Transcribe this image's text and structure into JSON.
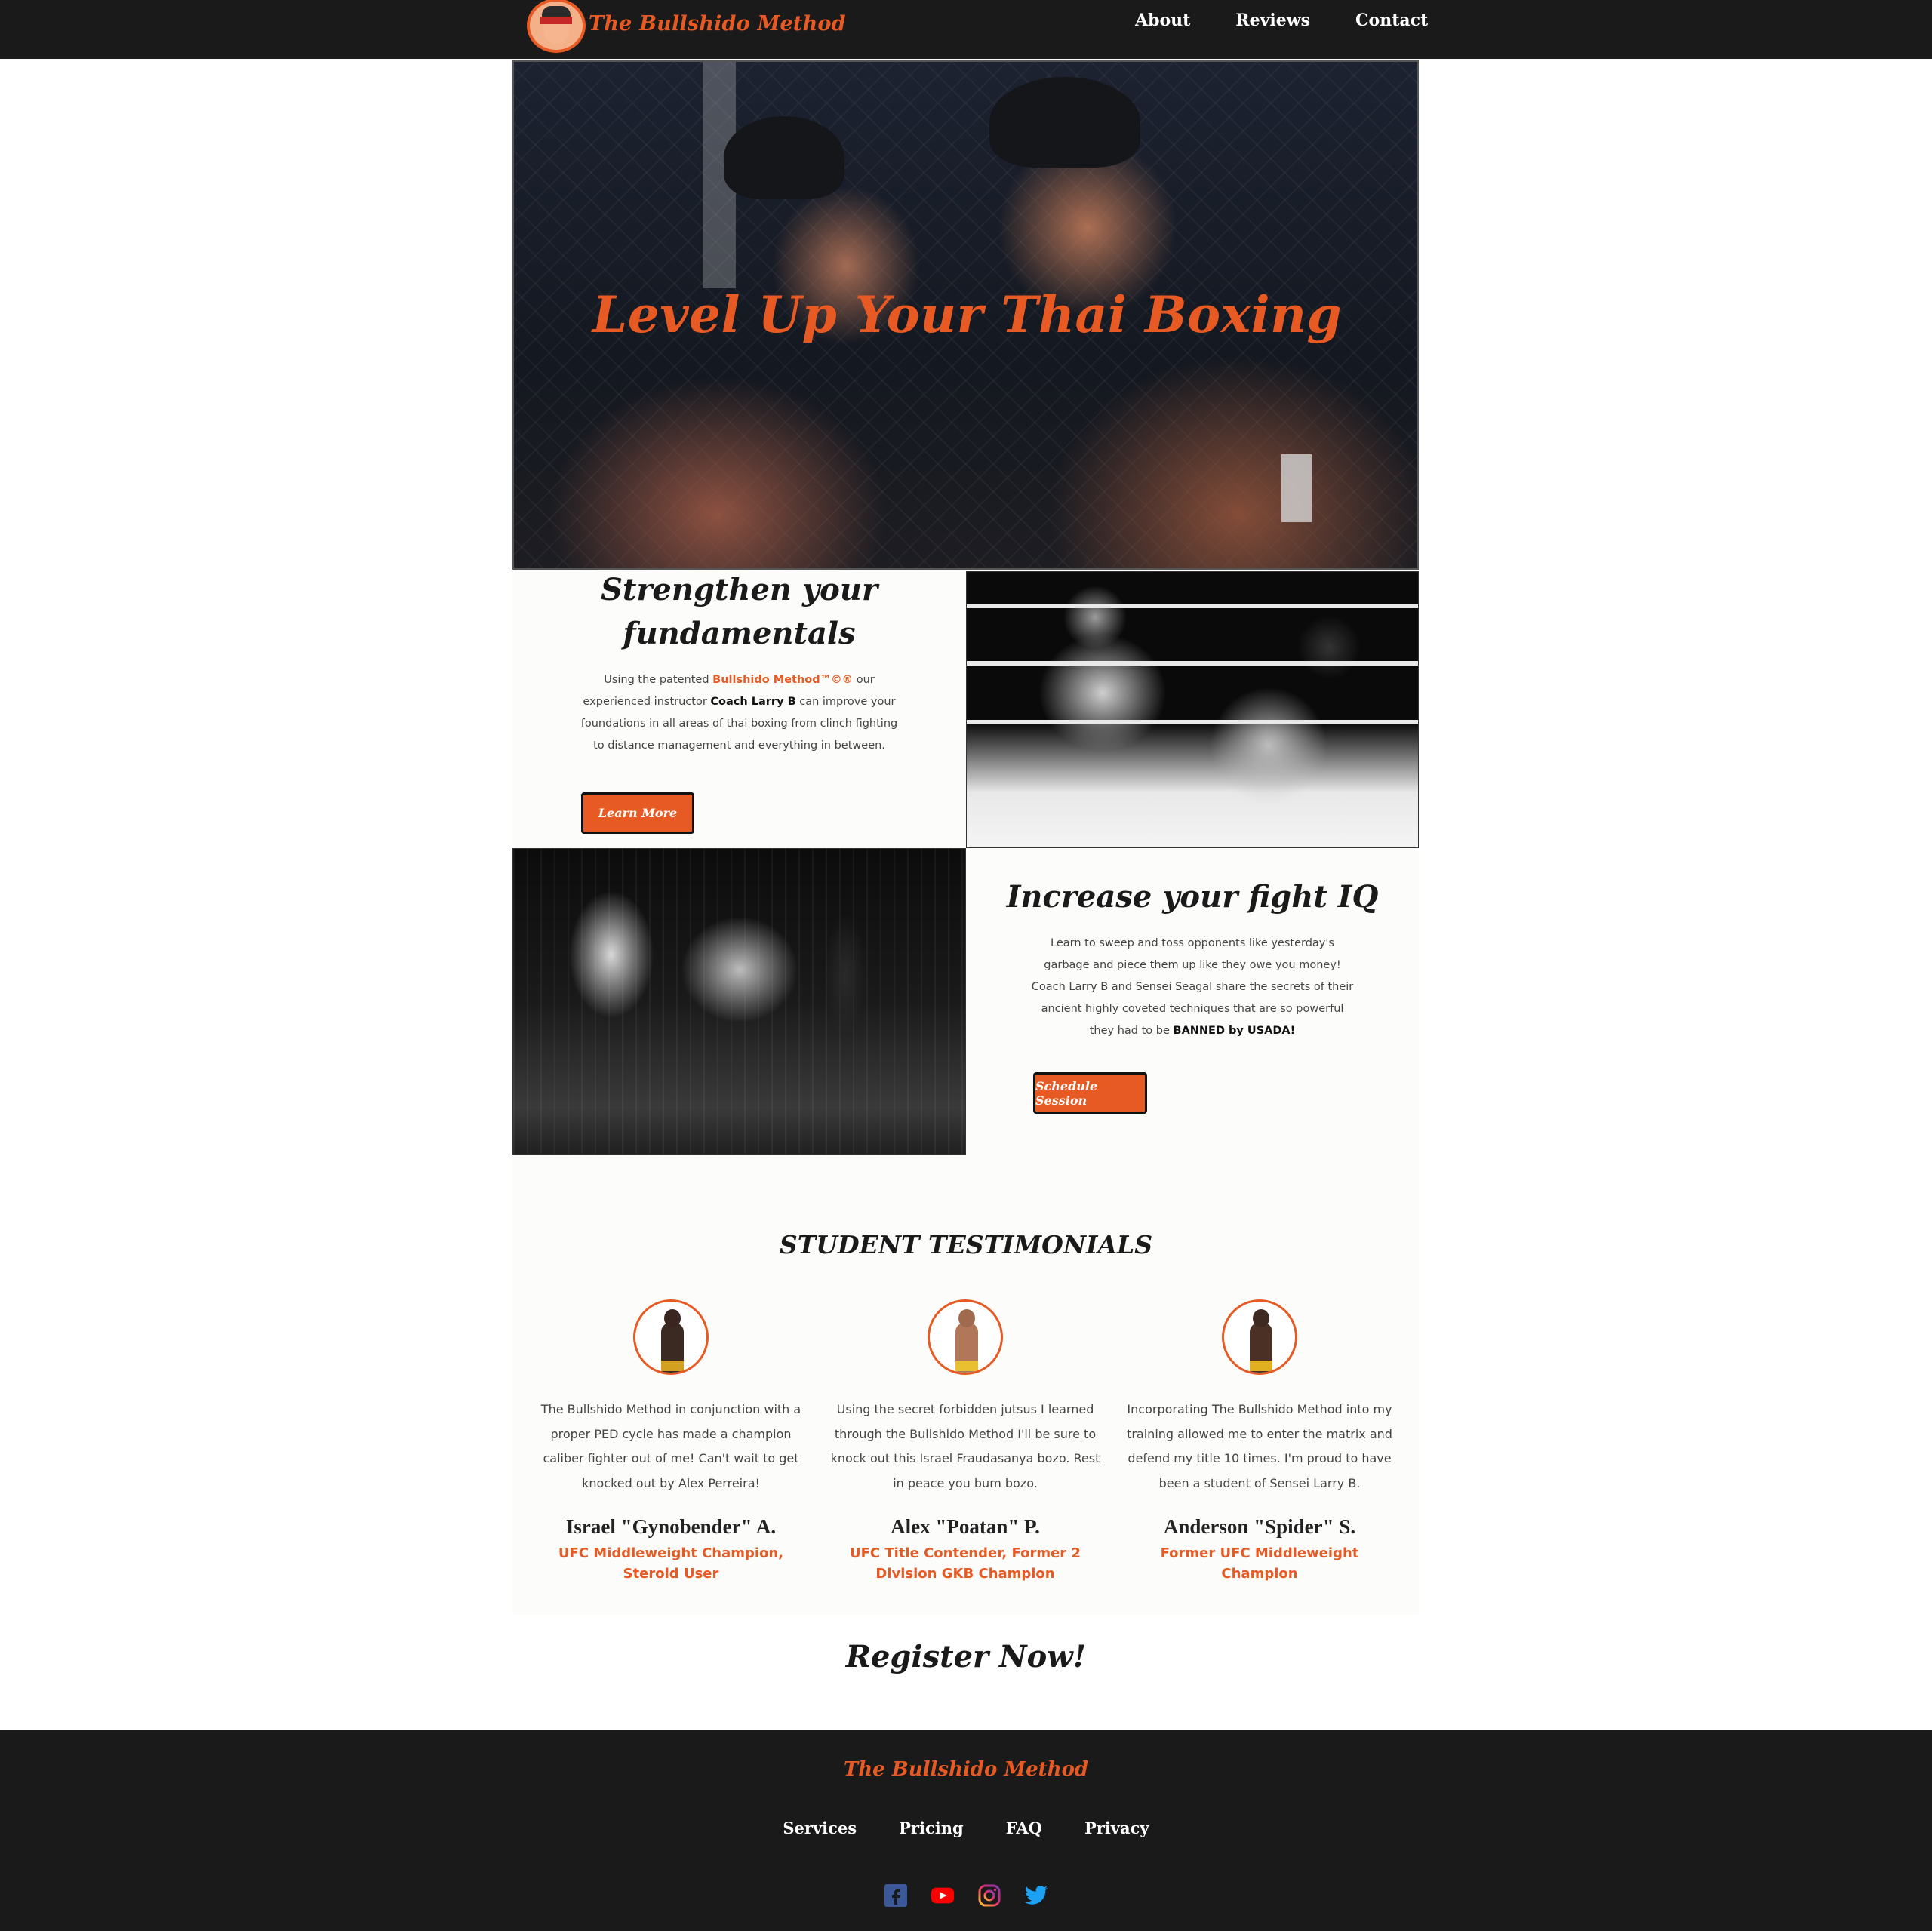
{
  "nav": {
    "brand": "The Bullshido Method",
    "links": [
      "About",
      "Reviews",
      "Contact"
    ]
  },
  "hero": {
    "title": "Level Up Your Thai Boxing"
  },
  "section1": {
    "title_line1": "Strengthen your",
    "title_line2": "fundamentals",
    "body_parts": {
      "p1": "Using the patented ",
      "brand": "Bullshido Method™©®",
      "p2": " our experienced instructor ",
      "coach": "Coach Larry B",
      "p3": " can improve your foundations in all areas of thai boxing from clinch fighting to distance management and everything in between."
    },
    "button": "Learn More"
  },
  "section2": {
    "title": "Increase your fight IQ",
    "body_parts": {
      "p1": "Learn to sweep and toss opponents like yesterday's garbage and piece them up like they owe you money! Coach Larry B and Sensei Seagal share the secrets of their ancient highly coveted techniques that are so powerful they had to be ",
      "banned": "BANNED by USADA!"
    },
    "button": "Schedule Session"
  },
  "testimonials": {
    "title": "STUDENT TESTIMONIALS",
    "items": [
      {
        "quote": "The Bullshido Method in conjunction with a proper PED cycle has made a champion caliber fighter out of me! Can't wait to get knocked out by Alex Perreira!",
        "name": "Israel \"Gynobender\" A.",
        "role": "UFC Middleweight Champion, Steroid User"
      },
      {
        "quote": "Using the secret forbidden jutsus I learned through the Bullshido Method I'll be sure to knock out this Israel Fraudasanya bozo. Rest in peace you bum bozo.",
        "name": "Alex \"Poatan\" P.",
        "role": "UFC Title Contender, Former 2 Division GKB Champion"
      },
      {
        "quote": "Incorporating The Bullshido Method into my training allowed me to enter the matrix and defend my title 10 times. I'm proud to have been a student of Sensei Larry B.",
        "name": "Anderson \"Spider\" S.",
        "role": "Former UFC Middleweight Champion"
      }
    ]
  },
  "register": "Register Now!",
  "footer": {
    "brand": "The Bullshido Method",
    "links": [
      "Services",
      "Pricing",
      "FAQ",
      "Privacy"
    ],
    "social": [
      "facebook-icon",
      "youtube-icon",
      "instagram-icon",
      "twitter-icon"
    ]
  },
  "colors": {
    "accent": "#e85a23",
    "dark": "#1a1a1a",
    "light": "#fcfdfb"
  }
}
